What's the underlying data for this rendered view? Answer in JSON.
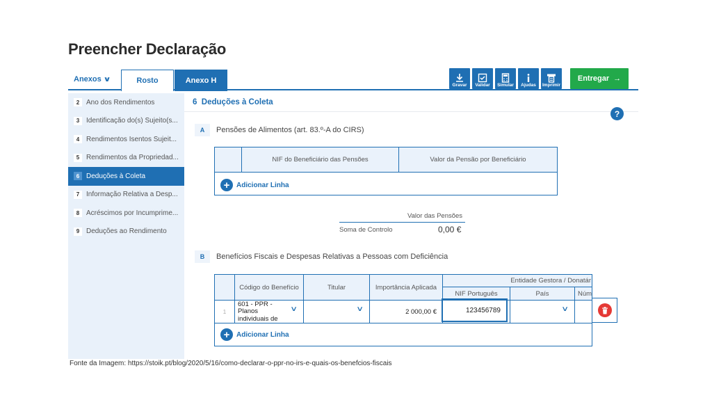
{
  "page_title": "Preencher Declaração",
  "tabs": {
    "anexos_label": "Anexos",
    "rosto": "Rosto",
    "anexo_h": "Anexo H"
  },
  "toolbar": {
    "gravar": "Gravar",
    "validar": "Validar",
    "simular": "Simular",
    "ajudas": "Ajudas",
    "imprimir": "Imprimir",
    "entregar": "Entregar"
  },
  "sidebar": {
    "items": [
      {
        "num": "2",
        "label": "Ano dos Rendimentos"
      },
      {
        "num": "3",
        "label": "Identificação do(s) Sujeito(s..."
      },
      {
        "num": "4",
        "label": "Rendimentos Isentos Sujeit..."
      },
      {
        "num": "5",
        "label": "Rendimentos da Propriedad..."
      },
      {
        "num": "6",
        "label": "Deduções à Coleta"
      },
      {
        "num": "7",
        "label": "Informação Relativa a Desp..."
      },
      {
        "num": "8",
        "label": "Acréscimos por Incumprime..."
      },
      {
        "num": "9",
        "label": "Deduções ao Rendimento"
      }
    ],
    "active_index": 4
  },
  "section": {
    "number": "6",
    "title": "Deduções à Coleta",
    "help": "?"
  },
  "subsection_a": {
    "letter": "A",
    "title": "Pensões de Alimentos (art. 83.º-A do CIRS)",
    "columns": [
      "NIF do Beneficiário das Pensões",
      "Valor da Pensão por Beneficiário"
    ],
    "add_line": "Adicionar Linha",
    "pensoes_label": "Valor das Pensões",
    "soma_label": "Soma de Controlo",
    "soma_value": "0,00 €"
  },
  "subsection_b": {
    "letter": "B",
    "title": "Benefícios Fiscais e Despesas Relativas a Pessoas com Deficiência",
    "columns": {
      "codigo": "Código do Benefício",
      "titular": "Titular",
      "importancia": "Importância Aplicada",
      "entidade": "Entidade Gestora / Donatár",
      "nif": "NIF Português",
      "pais": "País",
      "num": "Núm"
    },
    "row": {
      "index": "1",
      "codigo": "601 - PPR - Planos individuais de",
      "importancia": "2 000,00 €",
      "nif": "123456789"
    },
    "add_line": "Adicionar Linha"
  },
  "caption": "Fonte da Imagem: https://stoik.pt/blog/2020/5/16/como-declarar-o-ppr-no-irs-e-quais-os-benefcios-fiscais",
  "colors": {
    "primary": "#1f6fb3",
    "entregar": "#22a94a",
    "delete": "#e53935",
    "sidebar_bg": "#e9f1fa"
  }
}
